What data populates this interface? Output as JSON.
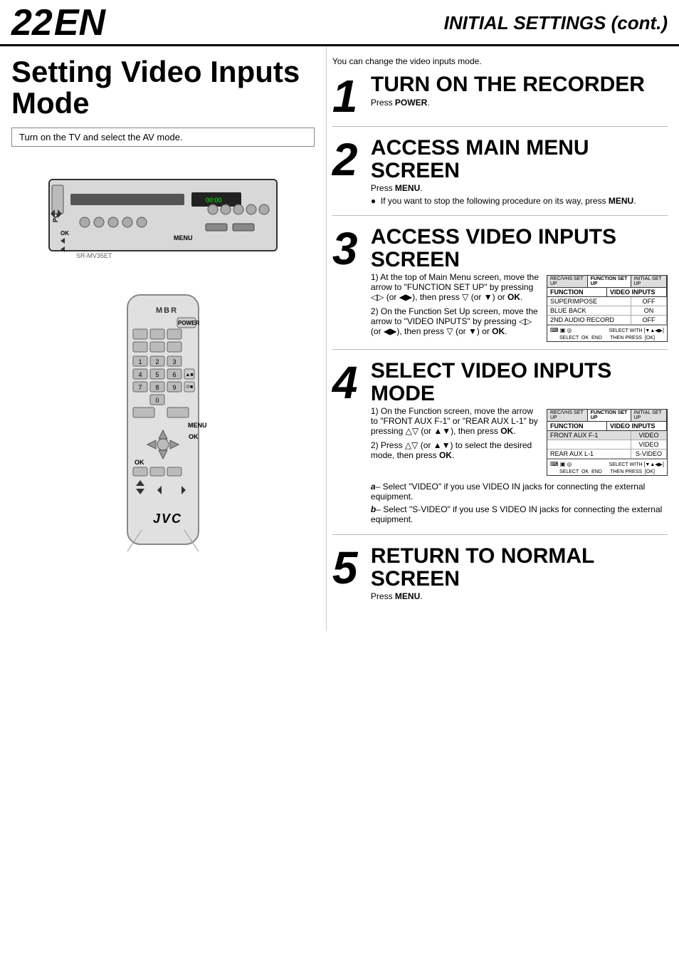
{
  "header": {
    "page_number": "22",
    "page_suffix": "EN",
    "title": "INITIAL SETTINGS (cont.)"
  },
  "page_section_title": "Setting Video Inputs Mode",
  "subtitle": "Turn on the TV and select the AV mode.",
  "intro": "You can change the video inputs mode.",
  "steps": [
    {
      "num": "1",
      "heading": "TURN ON THE RECORDER",
      "subtext": "Press POWER.",
      "subtext_bold": "POWER"
    },
    {
      "num": "2",
      "heading": "ACCESS MAIN MENU SCREEN",
      "subtext": "Press MENU.",
      "subtext_bold": "MENU",
      "note": "If you want to stop the following procedure on its way, press MENU.",
      "note_bold": "MENU"
    },
    {
      "num": "3",
      "heading": "ACCESS VIDEO INPUTS SCREEN",
      "instructions": [
        "1) At the top of Main Menu screen, move the arrow to \"FUNCTION SET UP\" by pressing ◁▷ (or ◀▶), then press ▽ (or ▼) or OK.",
        "2) On the Function Set Up screen, move the arrow to \"VIDEO INPUTS\" by pressing ◁▷ (or ◀▶), then press ▽ (or ▼) or OK."
      ],
      "screen1": {
        "tabs": [
          "REC/VHS SET UP",
          "FUNCTION SET UP",
          "INITIAL SET UP"
        ],
        "active_tab": "FUNCTION SET UP",
        "header_cols": [
          "FUNCTION",
          "VIDEO INPUTS"
        ],
        "rows": [
          {
            "label": "SUPERIMPOSE",
            "value": "OFF"
          },
          {
            "label": "BLUE BACK",
            "value": "ON"
          },
          {
            "label": "2ND AUDIO RECORD",
            "value": "OFF"
          }
        ],
        "bottom": "SELECT OK END    SELECT WITH [▼▲◀▶]    THEN PRESS   [OK]"
      }
    },
    {
      "num": "4",
      "heading": "SELECT VIDEO INPUTS MODE",
      "instructions": [
        "1) On the Function screen, move the arrow to \"FRONT AUX F-1\" or \"REAR AUX L-1\" by pressing △▽ (or ▲▼), then press OK.",
        "2) Press △▽ (or ▲▼) to select the desired mode, then press OK."
      ],
      "screen2": {
        "tabs": [
          "REC/VHS SET UP",
          "FUNCTION SET UP",
          "INITIAL SET UP"
        ],
        "active_tab": "FUNCTION SET UP",
        "header_cols": [
          "FUNCTION",
          "VIDEO INPUTS"
        ],
        "rows": [
          {
            "label": "FRONT AUX F-1",
            "value": "VIDEO"
          },
          {
            "label": "",
            "value": "VIDEO"
          },
          {
            "label": "REAR AUX L-1",
            "value": "S-VIDEO"
          }
        ],
        "bottom": "SELECT OK END    SELECT WITH [▼▲◀▶]    THEN PRESS   [OK]"
      },
      "alpha_items": [
        {
          "label": "a",
          "text": "– Select \"VIDEO\" if you use VIDEO IN jacks for connecting the external equipment."
        },
        {
          "label": "b",
          "text": "– Select \"S-VIDEO\" if you use S VIDEO IN jacks for connecting the external equipment."
        }
      ]
    },
    {
      "num": "5",
      "heading": "RETURN TO NORMAL SCREEN",
      "subtext": "Press MENU.",
      "subtext_bold": "MENU"
    }
  ],
  "remote": {
    "top_label": "MBR",
    "power_label": "POWER",
    "keys": [
      "1",
      "2",
      "3",
      "",
      "4",
      "5",
      "6",
      "▲■",
      "7",
      "8",
      "9",
      "⊙■",
      "",
      "0",
      "",
      ""
    ],
    "menu_label": "MENU",
    "ok_label": "OK",
    "jvc_logo": "JVC"
  },
  "vcr": {
    "power_label": "POWER",
    "menu_label": "MENU",
    "ok_label": "OK"
  }
}
